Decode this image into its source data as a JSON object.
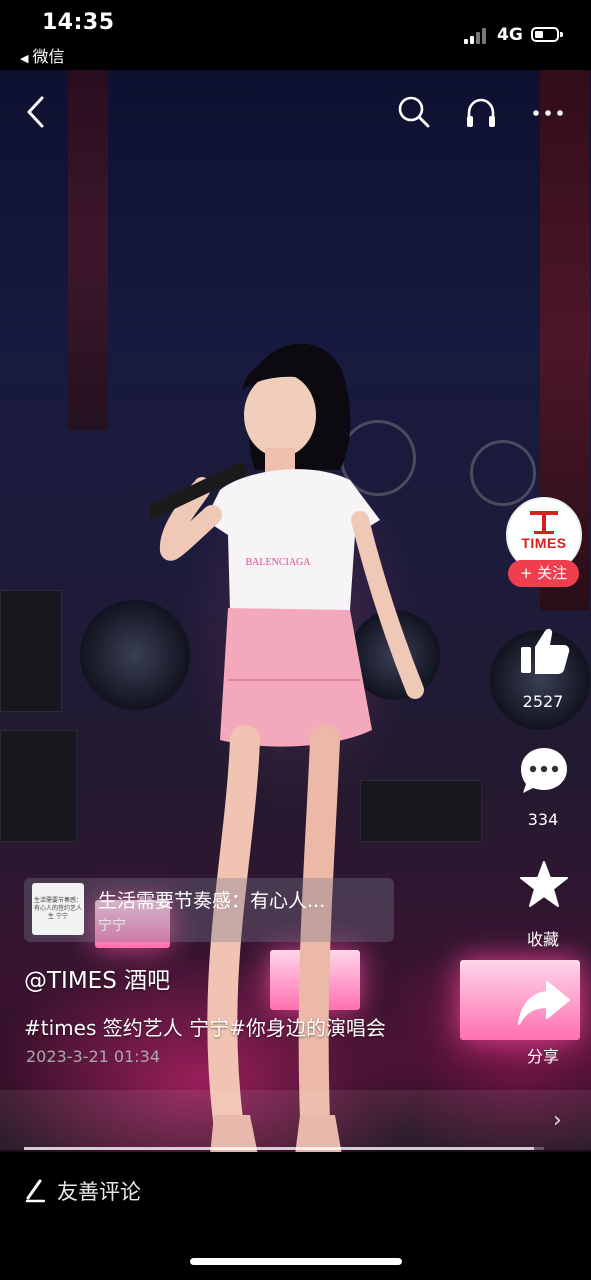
{
  "status_bar": {
    "time": "14:35",
    "back_app": "微信",
    "network": "4G"
  },
  "top_bar": {
    "icons": [
      "back-arrow-icon",
      "search-icon",
      "headphones-icon",
      "more-icon"
    ]
  },
  "video": {
    "shirt_text": "BALENCIAGA"
  },
  "side_actions": {
    "avatar_text": "TIMES",
    "follow_label": "+ 关注",
    "like_count": "2527",
    "comment_count": "334",
    "favorite_label": "收藏",
    "share_label": "分享"
  },
  "music": {
    "title": "生活需要节奏感：有心人...",
    "artist": "宁宁",
    "cover_text": "生活需要节奏感：有心人的签约艺人生 宁宁"
  },
  "post": {
    "author": "@TIMES 酒吧",
    "caption": "#times 签约艺人 宁宁#你身边的演唱会",
    "date": "2023-3-21 01:34"
  },
  "playback": {
    "progress": 0.98
  },
  "bottom_bar": {
    "comment_placeholder": "友善评论"
  },
  "colors": {
    "follow_red": "#ef3e4e",
    "stage_pink": "#ff6fb0",
    "brand_red": "#d5201c"
  }
}
